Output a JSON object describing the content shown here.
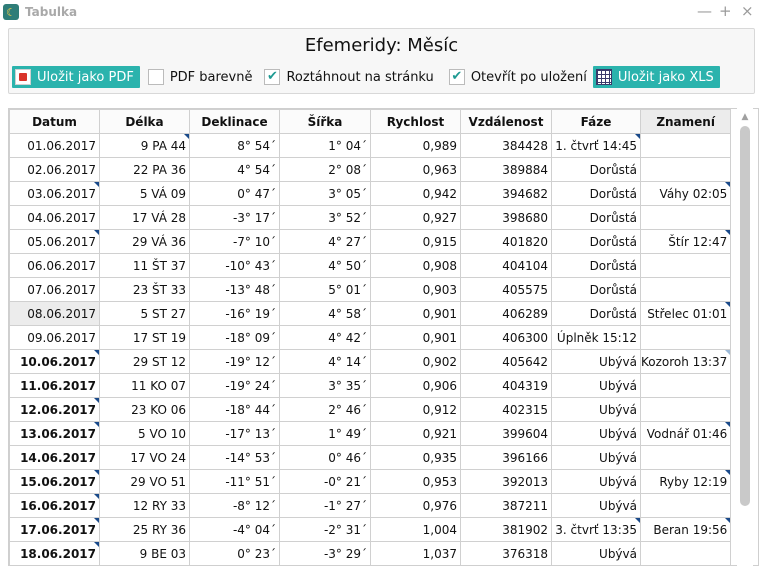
{
  "window": {
    "title": "Tabulka",
    "icon": "moon-app-icon",
    "controls": [
      "—",
      "+",
      "×"
    ]
  },
  "panel": {
    "title": "Efemeridy: Měsíc"
  },
  "toolbar": {
    "save_pdf_label": "Uložit jako PDF",
    "pdf_color_label": "PDF barevně",
    "pdf_color_checked": false,
    "stretch_label": "Roztáhnout na stránku",
    "stretch_checked": true,
    "open_after_label": "Otevřít po uložení",
    "open_after_checked": true,
    "save_xls_label": "Uložit jako XLS"
  },
  "table": {
    "columns": [
      "Datum",
      "Délka",
      "Deklinace",
      "Šířka",
      "Rychlost",
      "Vzdálenost",
      "Fáze",
      "Znamení"
    ],
    "rows": [
      [
        "01.06.2017",
        "9 PA 44",
        "8° 54´",
        "1° 04´",
        "0,989",
        "384428",
        "1. čtvrť 14:45",
        ""
      ],
      [
        "02.06.2017",
        "22 PA 36",
        "4° 54´",
        "2° 08´",
        "0,963",
        "389884",
        "Dorůstá",
        ""
      ],
      [
        "03.06.2017",
        "5 VÁ 09",
        "0° 47´",
        "3° 05´",
        "0,942",
        "394682",
        "Dorůstá",
        "Váhy 02:05"
      ],
      [
        "04.06.2017",
        "17 VÁ 28",
        "-3° 17´",
        "3° 52´",
        "0,927",
        "398680",
        "Dorůstá",
        ""
      ],
      [
        "05.06.2017",
        "29 VÁ 36",
        "-7° 10´",
        "4° 27´",
        "0,915",
        "401820",
        "Dorůstá",
        "Štír 12:47"
      ],
      [
        "06.06.2017",
        "11 ŠT 37",
        "-10° 43´",
        "4° 50´",
        "0,908",
        "404104",
        "Dorůstá",
        ""
      ],
      [
        "07.06.2017",
        "23 ŠT 33",
        "-13° 48´",
        "5° 01´",
        "0,903",
        "405575",
        "Dorůstá",
        ""
      ],
      [
        "08.06.2017",
        "5 ST 27",
        "-16° 19´",
        "4° 58´",
        "0,901",
        "406289",
        "Dorůstá",
        "Střelec 01:01"
      ],
      [
        "09.06.2017",
        "17 ST 19",
        "-18° 09´",
        "4° 42´",
        "0,901",
        "406300",
        "Úplněk 15:12",
        ""
      ],
      [
        "10.06.2017",
        "29 ST 12",
        "-19° 12´",
        "4° 14´",
        "0,902",
        "405642",
        "Ubývá",
        "Kozoroh 13:37"
      ],
      [
        "11.06.2017",
        "11 KO 07",
        "-19° 24´",
        "3° 35´",
        "0,906",
        "404319",
        "Ubývá",
        ""
      ],
      [
        "12.06.2017",
        "23 KO 06",
        "-18° 44´",
        "2° 46´",
        "0,912",
        "402315",
        "Ubývá",
        ""
      ],
      [
        "13.06.2017",
        "5 VO 10",
        "-17° 13´",
        "1° 49´",
        "0,921",
        "399604",
        "Ubývá",
        "Vodnář 01:46"
      ],
      [
        "14.06.2017",
        "17 VO 24",
        "-14° 53´",
        "0° 46´",
        "0,935",
        "396166",
        "Ubývá",
        ""
      ],
      [
        "15.06.2017",
        "29 VO 51",
        "-11° 51´",
        "-0° 21´",
        "0,953",
        "392013",
        "Ubývá",
        "Ryby 12:19"
      ],
      [
        "16.06.2017",
        "12 RY 33",
        "-8° 12´",
        "-1° 27´",
        "0,976",
        "387211",
        "Ubývá",
        ""
      ],
      [
        "17.06.2017",
        "25 RY 36",
        "-4° 04´",
        "-2° 31´",
        "1,004",
        "381902",
        "3. čtvrť 13:35",
        "Beran 19:56"
      ],
      [
        "18.06.2017",
        "9 BE 03",
        "0° 23´",
        "-3° 29´",
        "1,037",
        "376318",
        "Ubývá",
        ""
      ]
    ],
    "bold_dates_from_row": 9,
    "selected_row": 7,
    "selected_column": "Znamení"
  },
  "colors": {
    "accent": "#2bb3ad",
    "marker": "#1a4a8a",
    "selected": "#ececec"
  }
}
